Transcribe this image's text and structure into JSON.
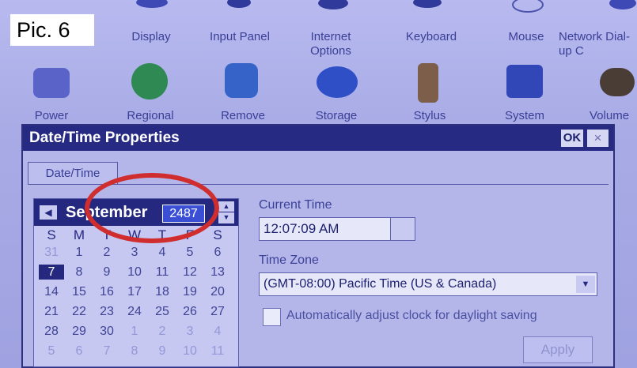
{
  "pic_label": "Pic. 6",
  "control_panel": {
    "row1": [
      "Display",
      "Input Panel",
      "Internet Options",
      "Keyboard",
      "Mouse",
      "Network Dial-up C"
    ],
    "row2": [
      "Power",
      "Regional",
      "Remove",
      "Storage",
      "Stylus",
      "System",
      "Volume"
    ]
  },
  "dialog": {
    "title": "Date/Time Properties",
    "ok": "OK",
    "close": "×",
    "tab": "Date/Time"
  },
  "calendar": {
    "prev": "◀",
    "month": "September",
    "year": "2487",
    "spin_up": "▲",
    "spin_down": "▼",
    "weekdays": [
      "S",
      "M",
      "T",
      "W",
      "T",
      "F",
      "S"
    ],
    "weeks": [
      [
        "31",
        "1",
        "2",
        "3",
        "4",
        "5",
        "6"
      ],
      [
        "7",
        "8",
        "9",
        "10",
        "11",
        "12",
        "13"
      ],
      [
        "14",
        "15",
        "16",
        "17",
        "18",
        "19",
        "20"
      ],
      [
        "21",
        "22",
        "23",
        "24",
        "25",
        "26",
        "27"
      ],
      [
        "28",
        "29",
        "30",
        "1",
        "2",
        "3",
        "4"
      ],
      [
        "5",
        "6",
        "7",
        "8",
        "9",
        "10",
        "11"
      ]
    ]
  },
  "current_time": {
    "label": "Current Time",
    "value": "12:07:09 AM"
  },
  "time_zone": {
    "label": "Time Zone",
    "value": "(GMT-08:00) Pacific Time (US & Canada)",
    "arrow": "▼"
  },
  "daylight": {
    "label": "Automatically adjust clock for daylight saving"
  },
  "apply": "Apply",
  "colors": {
    "titlebar": "#262a82",
    "annotation": "#d02e2e"
  }
}
